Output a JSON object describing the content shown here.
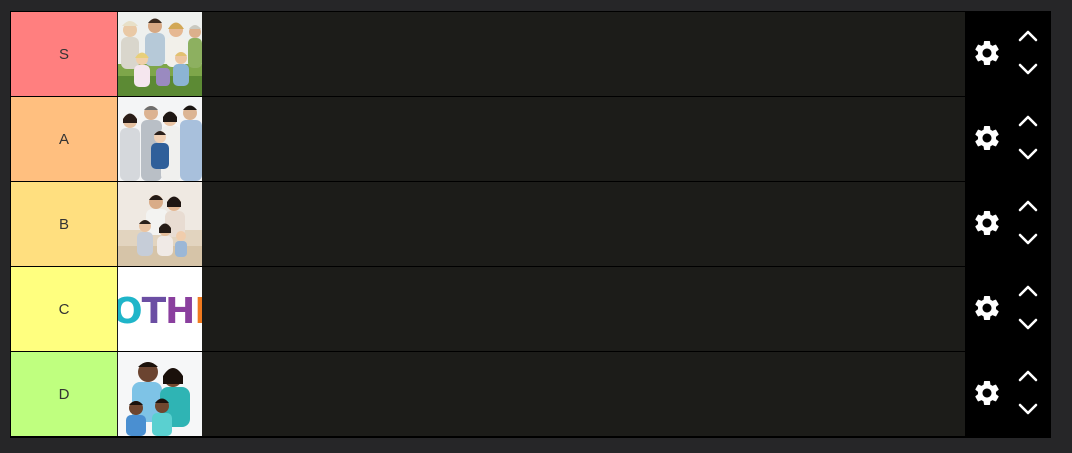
{
  "tiers": [
    {
      "label": "S",
      "color": "#ff7f7f",
      "item": "family-photo-grandparents"
    },
    {
      "label": "A",
      "color": "#ffbf7f",
      "item": "family-photo-asian-family"
    },
    {
      "label": "B",
      "color": "#ffdf7f",
      "item": "family-photo-sofa"
    },
    {
      "label": "C",
      "color": "#ffff7f",
      "item": "other-text-tile",
      "item_text": "OTHER"
    },
    {
      "label": "D",
      "color": "#bfff7f",
      "item": "family-photo-couple-kids"
    }
  ],
  "icons": {
    "settings": "gear-icon",
    "move_up": "chevron-up-icon",
    "move_down": "chevron-down-icon"
  }
}
